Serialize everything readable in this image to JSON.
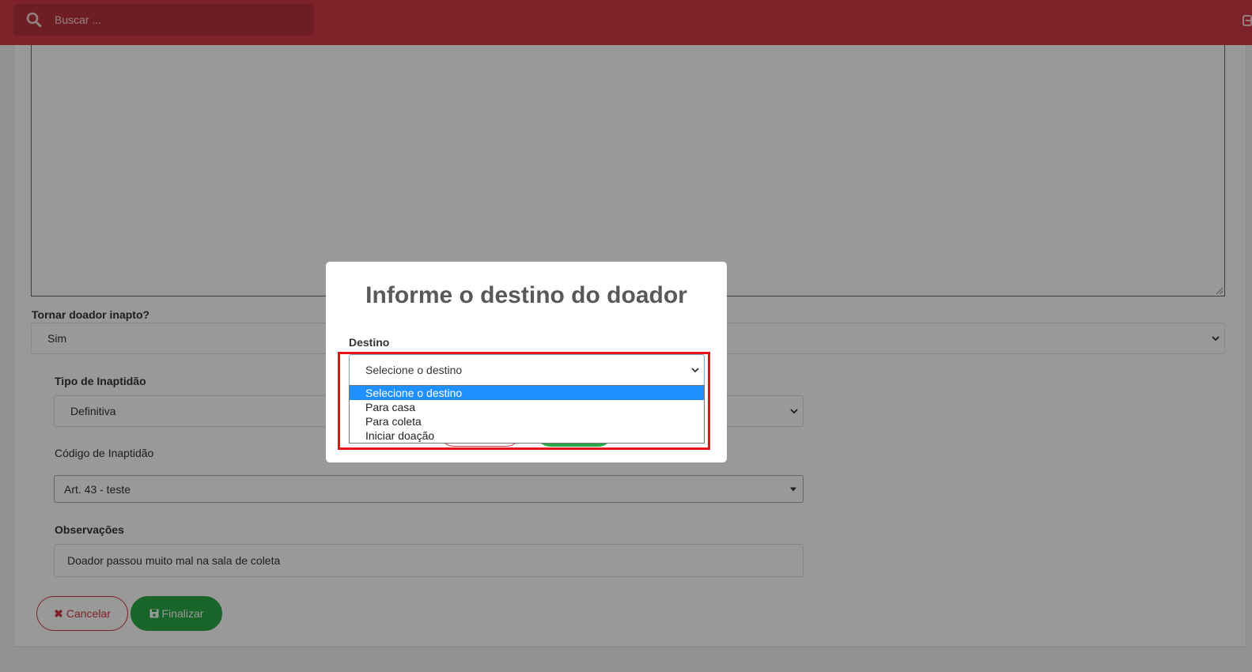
{
  "header": {
    "search_placeholder": "Buscar ...",
    "search_icon": "search-icon",
    "right_icon": "sign-out-icon",
    "color": "#d23a45"
  },
  "form": {
    "inapto_label": "Tornar doador inapto?",
    "inapto_value": "Sim",
    "tipo_label": "Tipo de Inaptidão",
    "tipo_value": "Definitiva",
    "codigo_label": "Código de Inaptidão",
    "codigo_value": "Art. 43 - teste",
    "obs_label": "Observações",
    "obs_value": "Doador passou muito mal na sala de coleta"
  },
  "actions": {
    "cancel_label": "Cancelar",
    "finish_label": "Finalizar"
  },
  "modal": {
    "title": "Informe o destino do doador",
    "field_label": "Destino",
    "selected_value": "Selecione o destino",
    "options": [
      "Selecione o destino",
      "Para casa",
      "Para coleta",
      "Iniciar doação"
    ]
  }
}
